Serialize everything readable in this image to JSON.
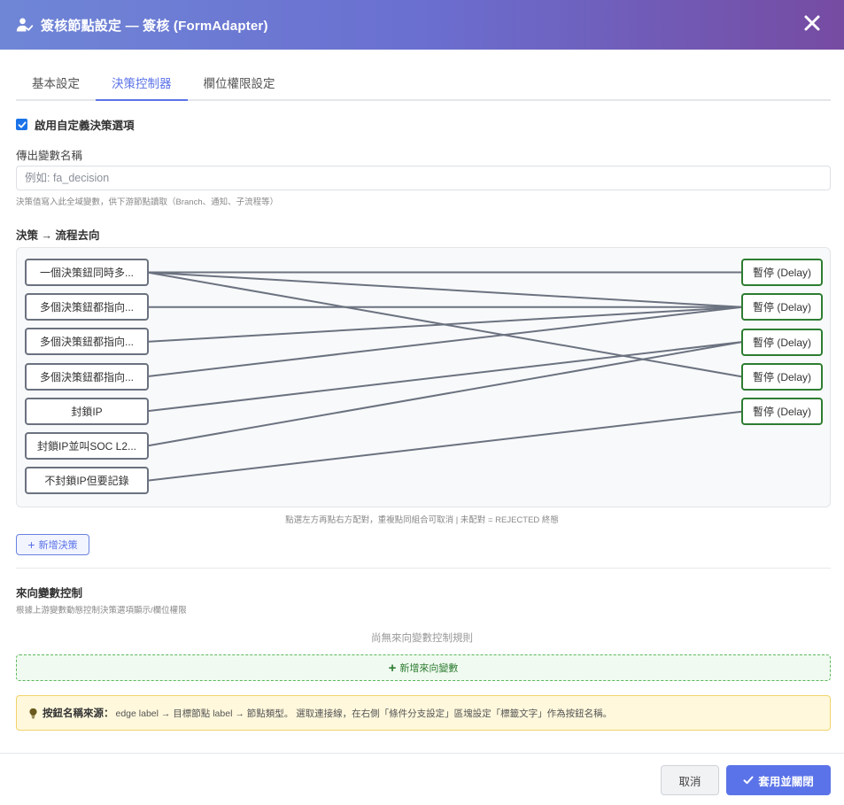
{
  "header": {
    "title": "簽核節點設定 — 簽核 (FormAdapter)",
    "icon": "user-check-icon",
    "close_icon": "close-icon"
  },
  "tabs": [
    {
      "label": "基本設定",
      "active": false
    },
    {
      "label": "決策控制器",
      "active": true
    },
    {
      "label": "欄位權限設定",
      "active": false
    }
  ],
  "enable_custom": {
    "label": "啟用自定義決策選項",
    "checked": true
  },
  "output_var": {
    "label": "傳出變數名稱",
    "placeholder": "例如: fa_decision",
    "value": "",
    "hint": "決策值寫入此全域變數，供下游節點讀取（Branch、通知、子流程等）"
  },
  "mapping": {
    "title": "決策 → 流程去向",
    "decisions": [
      {
        "label": "一個決策鈕同時多..."
      },
      {
        "label": "多個決策鈕都指向..."
      },
      {
        "label": "多個決策鈕都指向..."
      },
      {
        "label": "多個決策鈕都指向..."
      },
      {
        "label": "封鎖IP"
      },
      {
        "label": "封鎖IP並叫SOC L2..."
      },
      {
        "label": "不封鎖IP但要記錄"
      }
    ],
    "targets": [
      {
        "label": "暫停 (Delay)"
      },
      {
        "label": "暫停 (Delay)"
      },
      {
        "label": "暫停 (Delay)"
      },
      {
        "label": "暫停 (Delay)"
      },
      {
        "label": "暫停 (Delay)"
      }
    ],
    "links": [
      [
        0,
        0
      ],
      [
        0,
        1
      ],
      [
        0,
        3
      ],
      [
        1,
        1
      ],
      [
        2,
        1
      ],
      [
        3,
        1
      ],
      [
        4,
        2
      ],
      [
        5,
        2
      ],
      [
        6,
        4
      ]
    ],
    "line_color": "#6b7280",
    "hint": "點選左方再點右方配對，重複點同組合可取消 | 未配對 = REJECTED 終態",
    "add_label": "新增決策"
  },
  "incoming": {
    "title": "來向變數控制",
    "subtitle": "根據上游變數動態控制決策選項顯示/欄位權限",
    "empty": "尚無來向變數控制規則",
    "add_label": "新增來向變數"
  },
  "info": {
    "title": "按鈕名稱來源：",
    "text": "edge label → 目標節點 label → 節點類型。 選取連接線，在右側「條件分支設定」區塊設定「標籤文字」作為按鈕名稱。"
  },
  "footer": {
    "cancel": "取消",
    "apply": "套用並關閉"
  },
  "colors": {
    "accent": "#5b73e8",
    "target_border": "#2e7d32",
    "decision_border": "#6b7280"
  }
}
